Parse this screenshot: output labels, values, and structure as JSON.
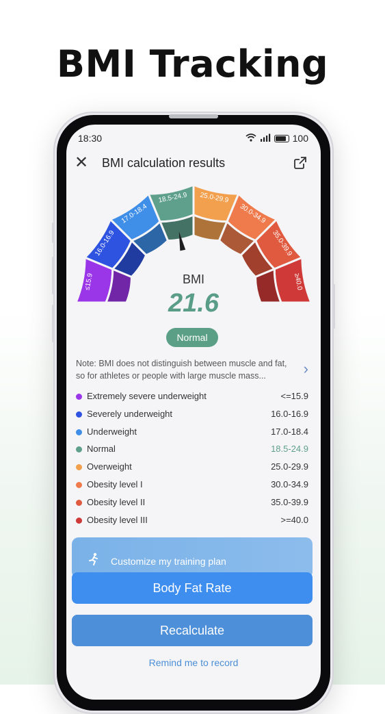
{
  "headline": "BMI Tracking",
  "status": {
    "time": "18:30",
    "battery": "100"
  },
  "header": {
    "title": "BMI calculation results"
  },
  "gauge": {
    "segments": [
      {
        "label": "≤15.9",
        "color": "#9b35e8"
      },
      {
        "label": "16.0-16.9",
        "color": "#2d53e0"
      },
      {
        "label": "17.0-18.4",
        "color": "#3f8ee8"
      },
      {
        "label": "18.5-24.9",
        "color": "#5ea08c"
      },
      {
        "label": "25.0-29.9",
        "color": "#f2a04e"
      },
      {
        "label": "30.0-34.9",
        "color": "#ef7b4c"
      },
      {
        "label": "35.0-39.9",
        "color": "#e05a3f"
      },
      {
        "label": "≥40.0",
        "color": "#cf3a38"
      }
    ],
    "needle_value": 21.6
  },
  "result": {
    "label": "BMI",
    "value": "21.6",
    "category": "Normal"
  },
  "note": "Note: BMI does not distinguish between muscle and fat, so for athletes or people with large muscle mass...",
  "legend": [
    {
      "label": "Extremely severe underweight",
      "range": "<=15.9",
      "color": "#9b35e8",
      "range_color": "#333333"
    },
    {
      "label": "Severely underweight",
      "range": "16.0-16.9",
      "color": "#2d53e0",
      "range_color": "#333333"
    },
    {
      "label": "Underweight",
      "range": "17.0-18.4",
      "color": "#3f8ee8",
      "range_color": "#333333"
    },
    {
      "label": "Normal",
      "range": "18.5-24.9",
      "color": "#5ea08c",
      "range_color": "#5ea08c"
    },
    {
      "label": "Overweight",
      "range": "25.0-29.9",
      "color": "#f2a04e",
      "range_color": "#333333"
    },
    {
      "label": "Obesity level I",
      "range": "30.0-34.9",
      "color": "#ef7b4c",
      "range_color": "#333333"
    },
    {
      "label": "Obesity level II",
      "range": "35.0-39.9",
      "color": "#e05a3f",
      "range_color": "#333333"
    },
    {
      "label": "Obesity level III",
      "range": ">=40.0",
      "color": "#cf3a38",
      "range_color": "#333333"
    }
  ],
  "banner": {
    "text": "Customize my training plan"
  },
  "buttons": {
    "body_fat": "Body Fat Rate",
    "recalculate": "Recalculate",
    "remind": "Remind me to record"
  },
  "icons": {
    "close": "close-icon",
    "share": "share-icon",
    "runner": "runner-icon",
    "chevron": "chevron-right-icon"
  }
}
